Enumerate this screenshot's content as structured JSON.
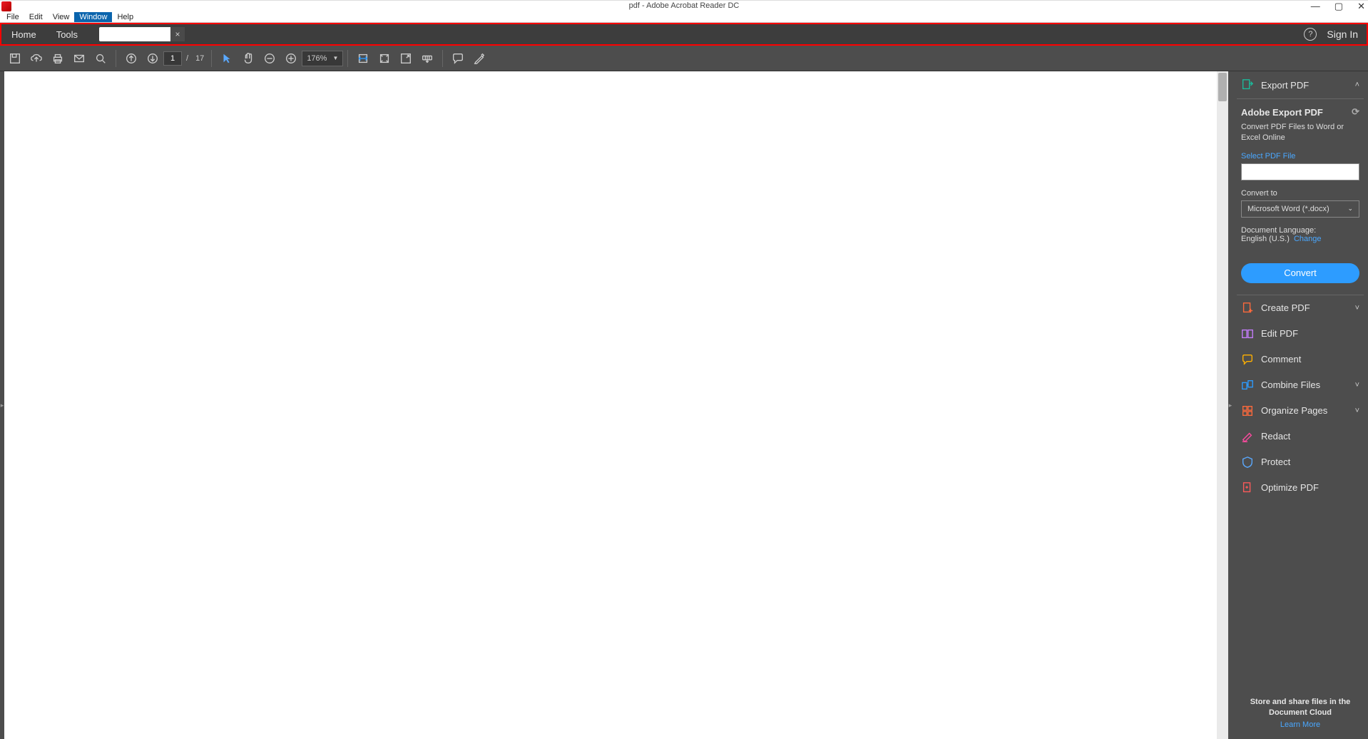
{
  "titlebar": {
    "title": "pdf - Adobe Acrobat Reader DC"
  },
  "menubar": {
    "items": [
      "File",
      "Edit",
      "View",
      "Window",
      "Help"
    ],
    "highlighted_index": 3
  },
  "tabstrip": {
    "home": "Home",
    "tools": "Tools",
    "signin": "Sign In"
  },
  "toolbar": {
    "page_current": "1",
    "page_sep": "/",
    "page_total": "17",
    "zoom": "176%"
  },
  "rpanel": {
    "export": {
      "head": "Export PDF",
      "title": "Adobe Export PDF",
      "sub": "Convert PDF Files to Word or Excel Online",
      "select_label": "Select PDF File",
      "convert_to": "Convert to",
      "convert_option": "Microsoft Word (*.docx)",
      "lang_label": "Document Language:",
      "lang_value": "English (U.S.)",
      "change": "Change",
      "convert_btn": "Convert"
    },
    "tools": [
      {
        "label": "Create PDF",
        "chev": true,
        "color": "#ff6a3c"
      },
      {
        "label": "Edit PDF",
        "chev": false,
        "color": "#c77dff"
      },
      {
        "label": "Comment",
        "chev": false,
        "color": "#ffb000"
      },
      {
        "label": "Combine Files",
        "chev": true,
        "color": "#2d9cff"
      },
      {
        "label": "Organize Pages",
        "chev": true,
        "color": "#ff6a3c"
      },
      {
        "label": "Redact",
        "chev": false,
        "color": "#ff4aa0"
      },
      {
        "label": "Protect",
        "chev": false,
        "color": "#5aa9ff"
      },
      {
        "label": "Optimize PDF",
        "chev": false,
        "color": "#ff5a5a"
      }
    ],
    "footer": {
      "line": "Store and share files in the Document Cloud",
      "learn": "Learn More"
    }
  }
}
